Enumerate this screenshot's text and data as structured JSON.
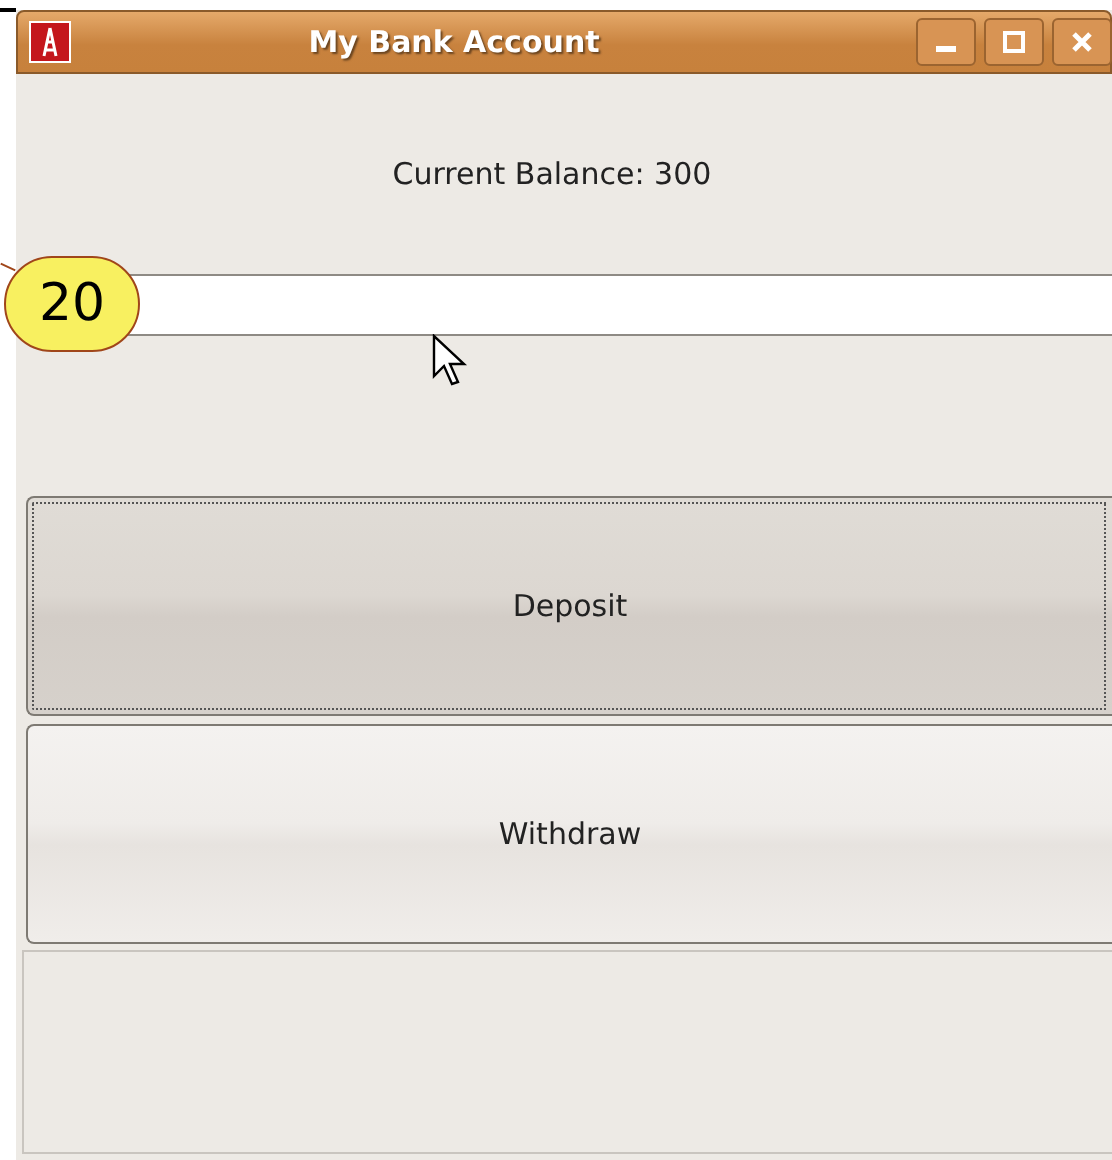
{
  "window": {
    "title": "My Bank Account"
  },
  "balance_label": "Current Balance: 300",
  "callout": {
    "label": "20"
  },
  "buttons": [
    {
      "label": "Deposit",
      "focused": true
    },
    {
      "label": "Withdraw",
      "focused": false
    }
  ]
}
